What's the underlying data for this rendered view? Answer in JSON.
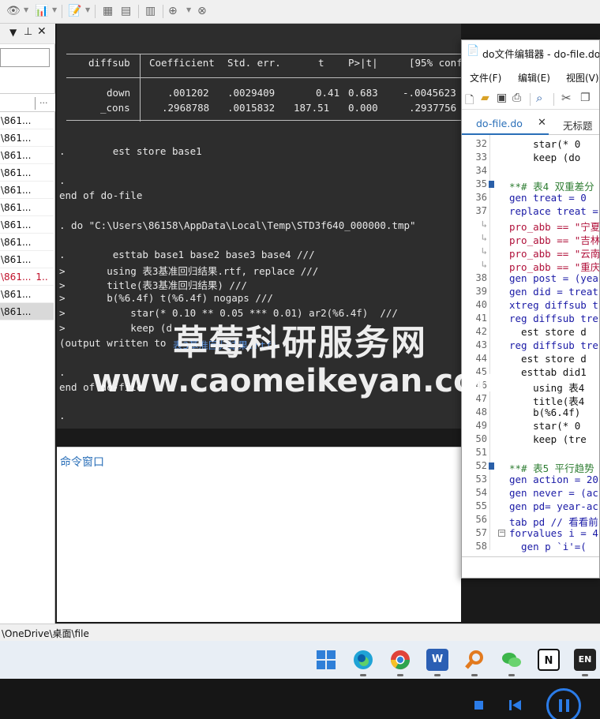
{
  "results": {
    "table_header": {
      "varname": "diffsub",
      "coef": "Coefficient",
      "se": "Std. err.",
      "t": "t",
      "p": "P>|t|",
      "ci": "[95% conf"
    },
    "table_rows": [
      {
        "var": "down",
        "coef": ".001202",
        "se": ".0029409",
        "t": "0.41",
        "p": "0.683",
        "ci": "-.0045623"
      },
      {
        "var": "_cons",
        "coef": ".2968788",
        "se": ".0015832",
        "t": "187.51",
        "p": "0.000",
        "ci": ".2937756"
      }
    ],
    "lines": [
      ".        est store base1",
      ".",
      "end of do-file",
      ". do \"C:\\Users\\86158\\AppData\\Local\\Temp\\STD3f640_000000.tmp\"",
      ".        esttab base1 base2 base3 base4 ///",
      ">       using 表3基准回归结果.rtf, replace ///",
      ">       title(表3基准回归结果) ///",
      ">       b(%6.4f) t(%6.4f) nogaps ///",
      ">           star(* 0.10 ** 0.05 *** 0.01) ar2(%6.4f)  ///",
      ">           keep (d",
      "(output written to ",
      "表3基准回归结果.rtf)",
      ".",
      "end of do-file",
      "."
    ]
  },
  "command_window": {
    "title": "命令窗口"
  },
  "left_panel": {
    "rows": [
      "\\861...",
      "\\861...",
      "\\861...",
      "\\861...",
      "\\861...",
      "\\861...",
      "\\861...",
      "\\861...",
      "\\861...",
      "\\861...",
      "\\861...",
      "\\861..."
    ],
    "highlight_row_text": "\\861...",
    "highlight_row_suffix": "1..",
    "col_more": "..."
  },
  "statusbar": {
    "path": "\\OneDrive\\桌面\\file"
  },
  "editor": {
    "title": "do文件编辑器 - do-file.do",
    "menu": [
      "文件(F)",
      "编辑(E)",
      "视图(V)"
    ],
    "tabs": [
      {
        "label": "do-file.do",
        "close": "✕"
      },
      {
        "label": "无标题"
      }
    ],
    "lines": [
      {
        "n": "32",
        "code": "    star(* 0"
      },
      {
        "n": "33",
        "code": "    keep (do"
      },
      {
        "n": "34",
        "code": ""
      },
      {
        "n": "35",
        "code": "**# 表4 双重差分"
      },
      {
        "n": "36",
        "code": "gen treat = 0"
      },
      {
        "n": "37",
        "code": "replace treat ="
      },
      {
        "n": "",
        "code": "pro_abb == \"宁夏"
      },
      {
        "n": "",
        "code": "pro_abb == \"吉林"
      },
      {
        "n": "",
        "code": "pro_abb == \"云南"
      },
      {
        "n": "",
        "code": "pro_abb == \"重庆"
      },
      {
        "n": "38",
        "code": "gen post = (yea"
      },
      {
        "n": "39",
        "code": "gen did = treat"
      },
      {
        "n": "40",
        "code": "xtreg diffsub t"
      },
      {
        "n": "41",
        "code": "reg diffsub tre"
      },
      {
        "n": "42",
        "code": "  est store d"
      },
      {
        "n": "43",
        "code": "reg diffsub tre"
      },
      {
        "n": "44",
        "code": "  est store d"
      },
      {
        "n": "45",
        "code": "  esttab did1"
      },
      {
        "n": "46",
        "code": "    using 表4"
      },
      {
        "n": "47",
        "code": "    title(表4"
      },
      {
        "n": "48",
        "code": "    b(%6.4f)"
      },
      {
        "n": "49",
        "code": "    star(* 0"
      },
      {
        "n": "50",
        "code": "    keep (tre"
      },
      {
        "n": "51",
        "code": ""
      },
      {
        "n": "52",
        "code": "**# 表5 平行趋势"
      },
      {
        "n": "53",
        "code": "gen action = 20"
      },
      {
        "n": "54",
        "code": "gen never = (ac"
      },
      {
        "n": "55",
        "code": "gen pd= year-ac"
      },
      {
        "n": "56",
        "code": "tab pd // 看看前"
      },
      {
        "n": "57",
        "code": "forvalues i = 4"
      },
      {
        "n": "58",
        "code": "  gen p `i'=("
      }
    ]
  },
  "taskbar": {
    "apps": [
      "windows-start",
      "edge-browser",
      "chrome-browser",
      "word",
      "search-magnifier",
      "wechat",
      "notion",
      "en-input"
    ],
    "word_label": "W",
    "notion_label": "N",
    "en_label": "EN"
  },
  "watermark": {
    "line1": "草莓科研服务网",
    "line2": "www.caomeikeyan.com"
  },
  "colors": {
    "results_bg": "#2d2d2d",
    "link_blue": "#5a8fd8",
    "cmd_title": "#2a6fb8",
    "editor_comment": "#2e7d32",
    "editor_string": "#b0103a",
    "editor_keyword": "#1a1aa6"
  }
}
